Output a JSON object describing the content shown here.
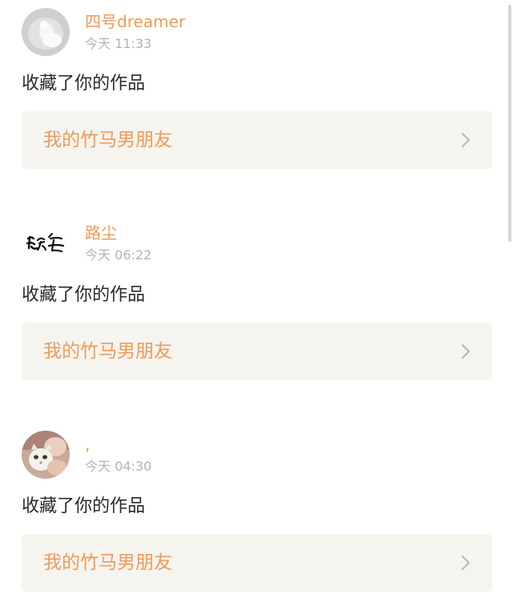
{
  "notifications": [
    {
      "user_name": "四号dreamer",
      "avatar_icon": "white-figure-avatar-icon",
      "timestamp": "今天 11:33",
      "action": "收藏了你的作品",
      "work_title": "我的竹马男朋友"
    },
    {
      "user_name": "路尘",
      "avatar_icon": "calligraphy-avatar-icon",
      "timestamp": "今天 06:22",
      "action": "收藏了你的作品",
      "work_title": "我的竹马男朋友"
    },
    {
      "user_name": ",",
      "avatar_icon": "cat-photo-avatar-icon",
      "timestamp": "今天 04:30",
      "action": "收藏了你的作品",
      "work_title": "我的竹马男朋友"
    }
  ],
  "colors": {
    "accent": "#ef9a5a",
    "timestamp": "#b3b3b3",
    "card_link_bg": "#f5f4ee",
    "separator": "#f7f7f5"
  },
  "icons": {
    "chevron": "chevron-right-icon"
  }
}
